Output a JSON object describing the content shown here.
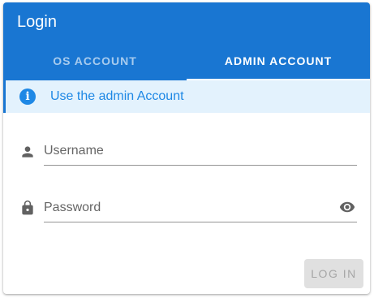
{
  "dialog": {
    "title": "Login"
  },
  "tabs": [
    {
      "label": "OS ACCOUNT",
      "active": false
    },
    {
      "label": "ADMIN ACCOUNT",
      "active": true
    }
  ],
  "info": {
    "icon": "info-icon",
    "message": "Use the admin Account"
  },
  "form": {
    "username": {
      "placeholder": "Username",
      "value": "",
      "icon": "person-icon"
    },
    "password": {
      "placeholder": "Password",
      "value": "",
      "icon": "lock-icon",
      "toggle_icon": "eye-icon"
    }
  },
  "actions": {
    "login_label": "LOG IN",
    "login_disabled": true
  },
  "colors": {
    "primary": "#1976d2",
    "info_background": "#e3f2fd",
    "info_text": "#1e88e5"
  }
}
